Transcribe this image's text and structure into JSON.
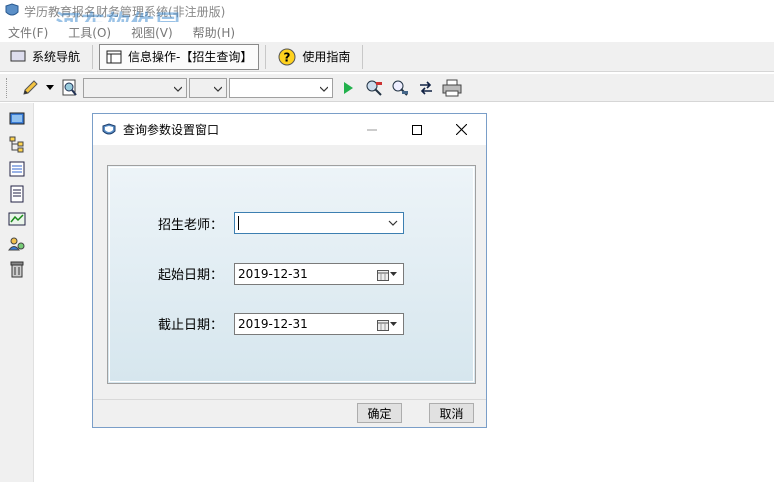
{
  "app": {
    "title": "学历教育报名财务管理系统(非注册版)",
    "watermark": "河东软件园",
    "watermark_sub": "www.pc0359.cn"
  },
  "menu": {
    "items": [
      "文件(F)",
      "工具(O)",
      "视图(V)",
      "帮助(H)"
    ]
  },
  "nav": {
    "system_nav": "系统导航",
    "info_op": "信息操作-【招生查询】",
    "guide": "使用指南"
  },
  "toolbar": {
    "combo3_value": ""
  },
  "dialog": {
    "title": "查询参数设置窗口",
    "teacher_label": "招生老师：",
    "teacher_value": "",
    "start_label": "起始日期：",
    "start_value": "2019-12-31",
    "end_label": "截止日期：",
    "end_value": "2019-12-31",
    "ok_label": "确定",
    "cancel_label": "取消"
  },
  "colors": {
    "accent": "#3c7fb1",
    "group_top": "#edf4f8",
    "group_bottom": "#d6e6ee"
  }
}
